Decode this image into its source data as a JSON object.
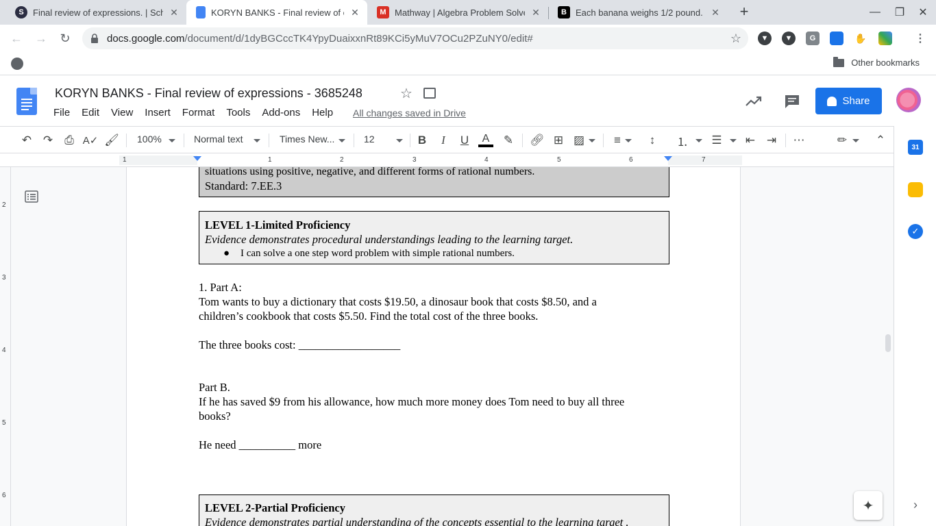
{
  "browser": {
    "tabs": [
      {
        "title": "Final review of expressions. | Sch",
        "favicon": "S",
        "favicon_color": "#2b2d42"
      },
      {
        "title": "KORYN BANKS - Final review of e",
        "favicon": "",
        "favicon_color": "#4285f4"
      },
      {
        "title": "Mathway | Algebra Problem Solve",
        "favicon": "M",
        "favicon_color": "#d93025"
      },
      {
        "title": "Each banana weighs 1/2 pound.",
        "favicon": "B",
        "favicon_color": "#000000"
      }
    ],
    "url_domain": "docs.google.com",
    "url_path": "/document/d/1dyBGCccTK4YpyDuaixxnRt89KCi5yMuV7OCu2PZuNY0/edit#",
    "other_bookmarks": "Other bookmarks"
  },
  "docs": {
    "title": "KORYN BANKS - Final review of expressions - 3685248",
    "menu": [
      "File",
      "Edit",
      "View",
      "Insert",
      "Format",
      "Tools",
      "Add-ons",
      "Help"
    ],
    "saved_status": "All changes saved in Drive",
    "share_label": "Share",
    "toolbar": {
      "zoom": "100%",
      "style": "Normal text",
      "font": "Times New...",
      "size": "12"
    },
    "ruler_h": [
      "1",
      "1",
      "2",
      "3",
      "4",
      "5",
      "6",
      "7"
    ],
    "ruler_v": [
      "2",
      "3",
      "4",
      "5",
      "6"
    ]
  },
  "document": {
    "top_box": {
      "line1": "situations using positive, negative, and different forms of rational numbers.",
      "line2": "Standard: 7.EE.3"
    },
    "level1": {
      "heading": "LEVEL 1-Limited Proficiency",
      "evidence": "Evidence demonstrates  procedural understandings leading to the learning target.",
      "bullet": "I can solve a one step word problem with simple rational numbers."
    },
    "q1_label": "1. Part A:",
    "q1_line1": "Tom wants to buy a dictionary that costs $19.50, a dinosaur book that costs $8.50, and a",
    "q1_line2": "children’s cookbook that costs $5.50. Find the total cost of the three books.",
    "q1_answer": "The three books cost: __________________",
    "q2_label": "Part B.",
    "q2_line1": "If he has saved $9 from his allowance, how much more money does Tom need to buy all three",
    "q2_line2": "books?",
    "q2_answer": "He need __________ more",
    "level2": {
      "heading": "LEVEL 2-Partial Proficiency",
      "evidence": "Evidence demonstrates partial understanding of the concepts essential to the learning target ."
    }
  },
  "colors": {
    "share_blue": "#1a73e8",
    "docs_blue": "#4285f4",
    "box_fill": "#efefef"
  }
}
